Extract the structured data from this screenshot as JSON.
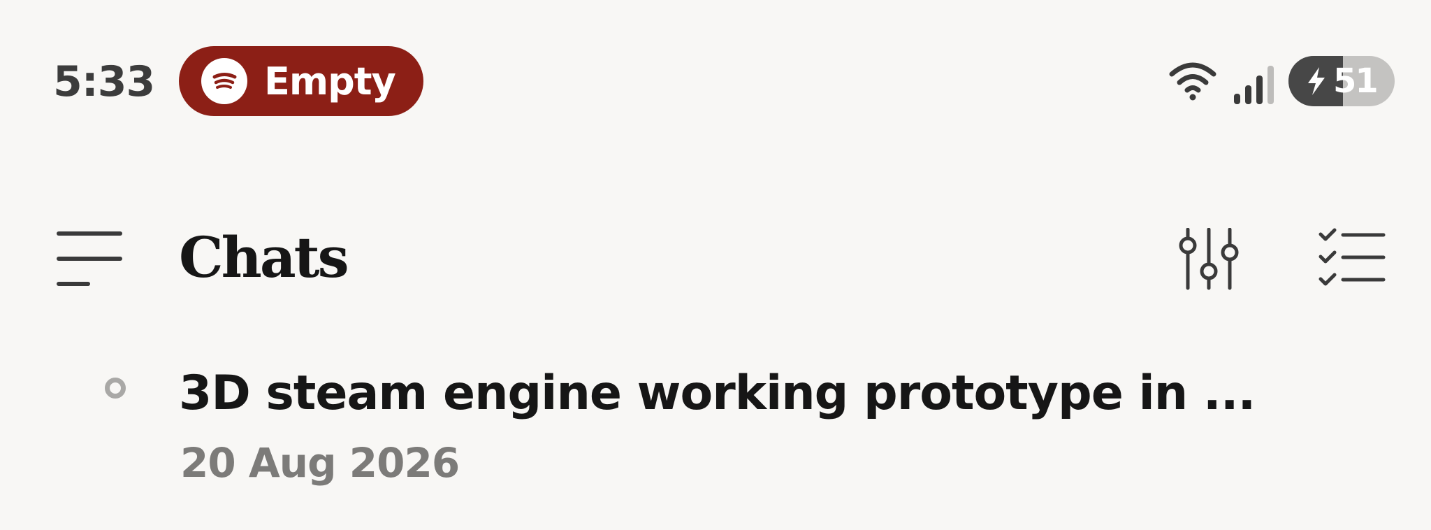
{
  "status_bar": {
    "time": "5:33",
    "media": {
      "app_icon": "spotify-icon",
      "label": "Empty",
      "color": "#8c1f16"
    },
    "wifi_icon": "wifi-icon",
    "signal_icon": "cellular-signal-icon",
    "battery": {
      "level": "51",
      "charging_icon": "lightning-bolt-icon"
    }
  },
  "header": {
    "menu_icon": "menu-icon",
    "title": "Chats",
    "filter_icon": "filter-sliders-icon",
    "select_icon": "checklist-icon"
  },
  "chats": [
    {
      "title": "3D steam engine working prototype in ...",
      "date": "20 Aug 2026",
      "status_icon": "status-dot-icon"
    }
  ],
  "colors": {
    "background": "#f8f7f5",
    "text_primary": "#161616",
    "text_secondary": "#7c7b79",
    "accent_pill": "#8c1f16"
  }
}
